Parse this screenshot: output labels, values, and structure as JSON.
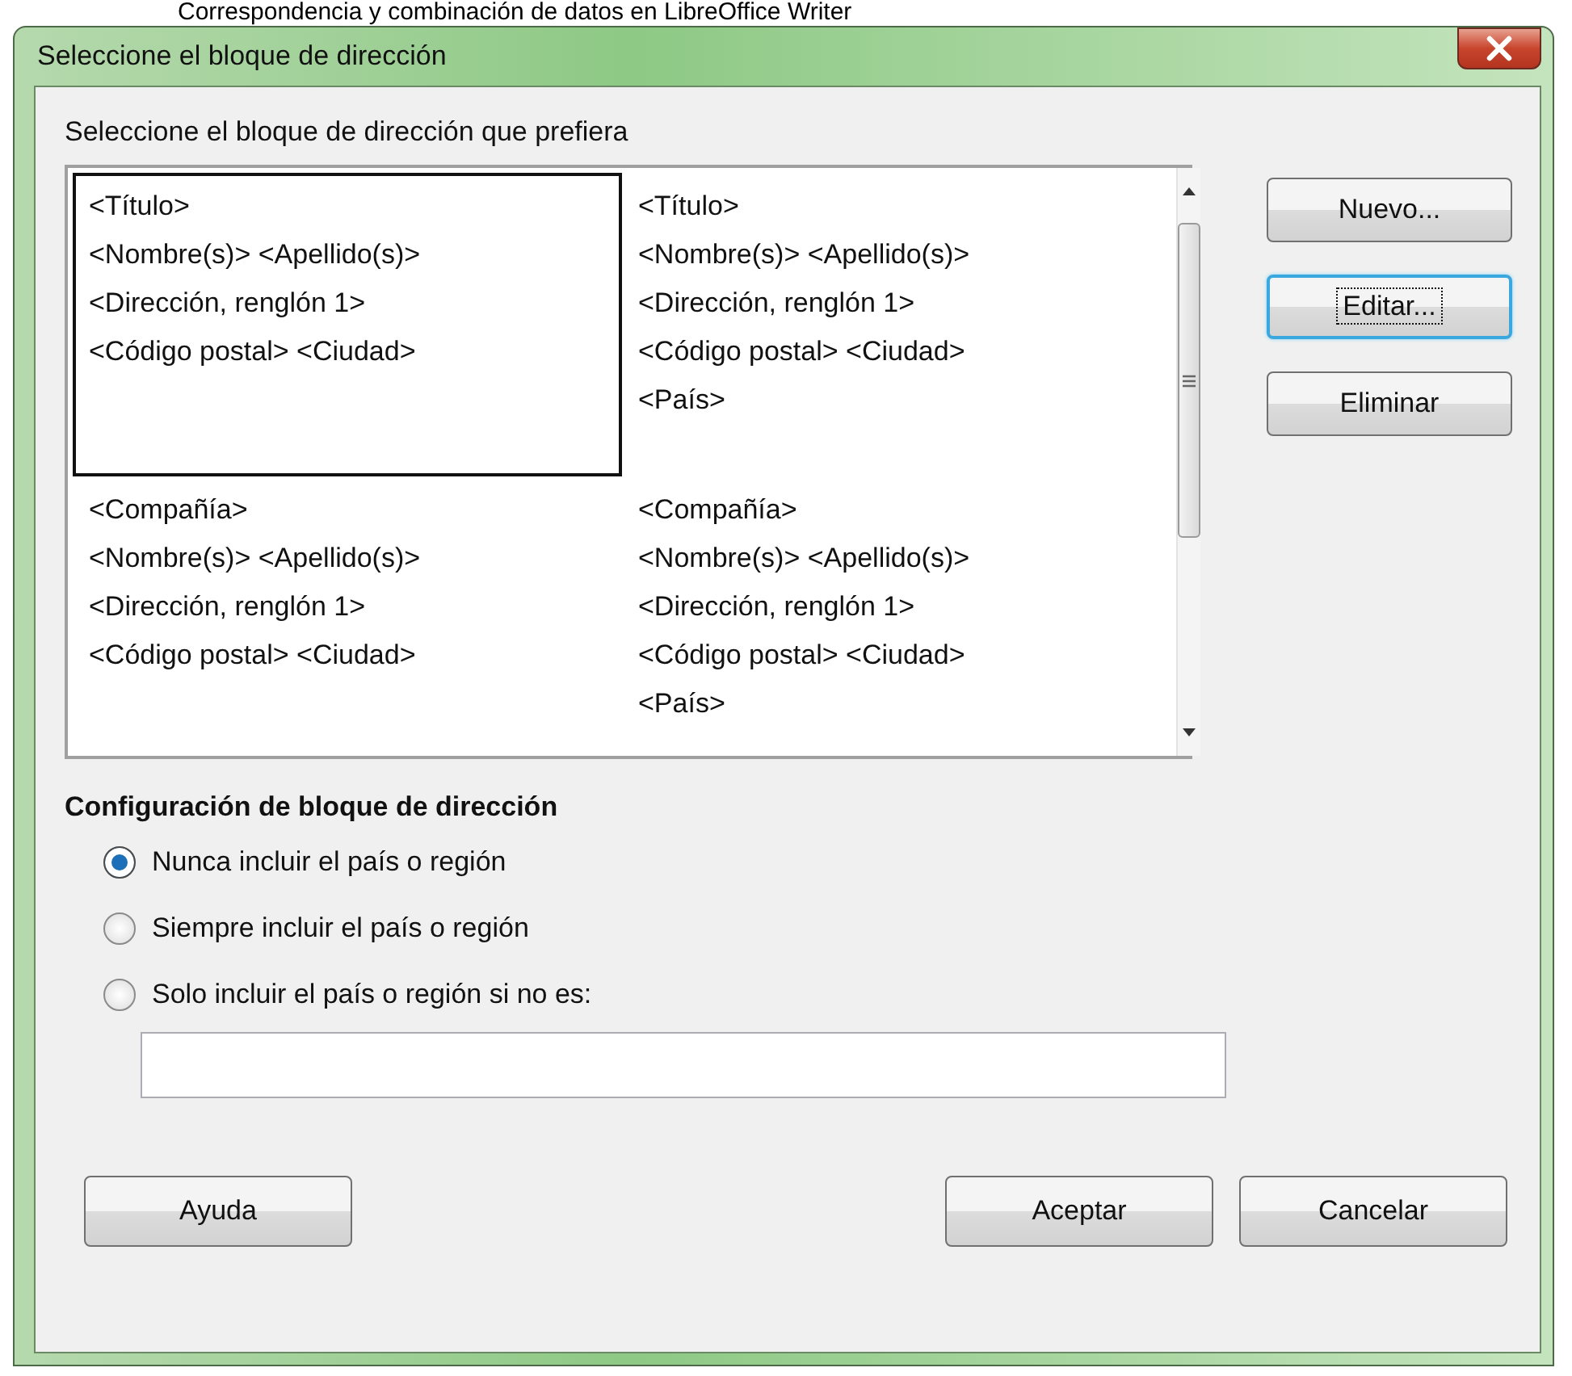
{
  "background_title": "Correspondencia y combinación de datos en LibreOffice Writer",
  "window": {
    "title": "Seleccione el bloque de dirección"
  },
  "list_label": "Seleccione el bloque de dirección que prefiera",
  "address_blocks": [
    {
      "lines": [
        "<Título>",
        "<Nombre(s)> <Apellido(s)>",
        "<Dirección, renglón 1>",
        "<Código postal> <Ciudad>"
      ],
      "selected": true
    },
    {
      "lines": [
        "<Título>",
        "<Nombre(s)> <Apellido(s)>",
        "<Dirección, renglón 1>",
        "<Código postal> <Ciudad>",
        "<País>"
      ],
      "selected": false
    },
    {
      "lines": [
        "<Compañía>",
        "<Nombre(s)> <Apellido(s)>",
        "<Dirección, renglón 1>",
        "<Código postal> <Ciudad>"
      ],
      "selected": false
    },
    {
      "lines": [
        "<Compañía>",
        "<Nombre(s)> <Apellido(s)>",
        "<Dirección, renglón 1>",
        "<Código postal> <Ciudad>",
        "<País>"
      ],
      "selected": false
    }
  ],
  "side_buttons": [
    {
      "label": "Nuevo...",
      "focused": false
    },
    {
      "label": "Editar...",
      "focused": true
    },
    {
      "label": "Eliminar",
      "focused": false
    }
  ],
  "settings": {
    "title": "Configuración de bloque de dirección",
    "options": [
      {
        "label": "Nunca incluir el país o región",
        "selected": true
      },
      {
        "label": "Siempre incluir el país o región",
        "selected": false
      },
      {
        "label": "Solo incluir el país o región si no es:",
        "selected": false
      }
    ]
  },
  "footer_buttons": [
    "Ayuda",
    "Aceptar",
    "Cancelar"
  ]
}
